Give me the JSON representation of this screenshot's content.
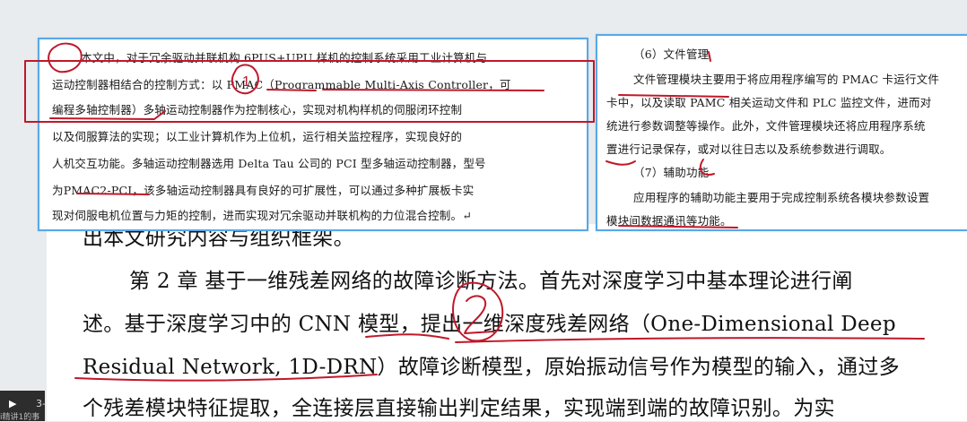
{
  "left_panel": {
    "lines": [
      "本文中，对于冗余驱动并联机构 6PUS+UPU 样机的控制系统采用工业计算机与",
      "运动控制器相结合的控制方式：以 PMAC（Programmable Multi-Axis Controller，可",
      "编程多轴控制器）多轴运动控制器作为控制核心，实现对机构样机的伺服闭环控制",
      "以及伺服算法的实现；以工业计算机作为上位机，运行相关监控程序，实现良好的",
      "人机交互功能。多轴运动控制器选用 Delta Tau 公司的 PCI 型多轴运动控制器，型号",
      "为PMAC2-PCI，该多轴运动控制器具有良好的可扩展性，可以通过多种扩展板卡实",
      "现对伺服电机位置与力矩的控制，进而实现对冗余驱动并联机构的力位混合控制。↵"
    ]
  },
  "right_panel": {
    "lines": [
      "（6）文件管理",
      "文件管理模块主要用于将应用程序编写的 PMAC 卡运行文件",
      "卡中，以及读取 PAMC 相关运动文件和 PLC 监控文件，进而对",
      "统进行参数调整等操作。此外，文件管理模块还将应用程序系统",
      "置进行记录保存，或对以往日志以及系统参数进行调取。",
      "（7）辅助功能",
      "应用程序的辅助功能主要用于完成控制系统各模块参数设置",
      "模块间数据通讯等功能。"
    ]
  },
  "page": {
    "lines": [
      "出本文研究内容与组织框架。",
      "第 2 章  基于一维残差网络的故障诊断方法。首先对深度学习中基本理论进行阐",
      "述。基于深度学习中的 CNN 模型，提出一维深度残差网络（One-Dimensional Deep",
      "Residual Network, 1D-DRN）故障诊断模型，原始振动信号作为模型的输入，通过多",
      "个残差模块特征提取，全连接层直接输出判定结果，实现端到端的故障识别。为实"
    ]
  },
  "annotations": {
    "mark_1": "1",
    "mark_2": "2"
  },
  "player": {
    "play_icon": "play-icon",
    "time": "3-",
    "caption": "i精讲1的事"
  },
  "colors": {
    "ink": "#c0182a",
    "panel_border": "#58a8e8"
  }
}
